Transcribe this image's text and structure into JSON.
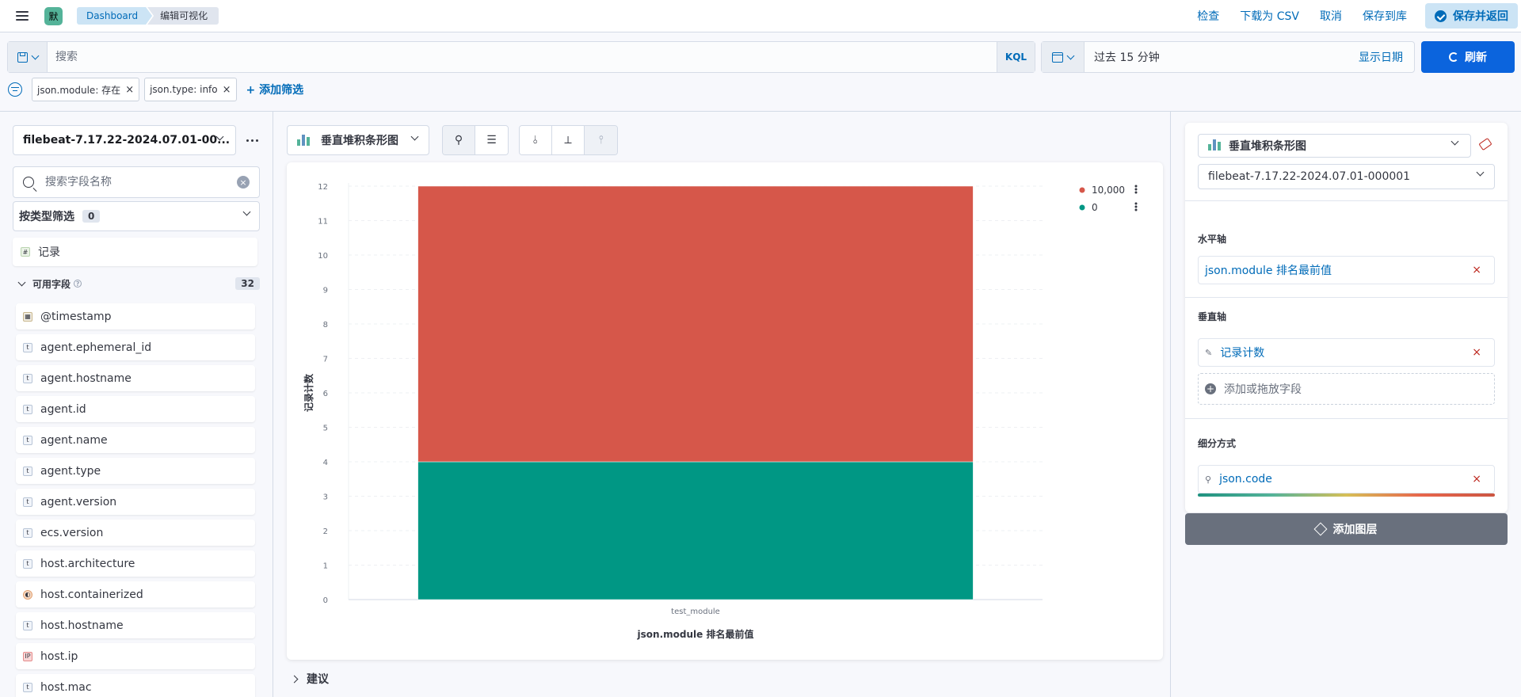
{
  "header": {
    "logo_letter": "默",
    "breadcrumbs": [
      "Dashboard",
      "编辑可视化"
    ],
    "actions": [
      "检查",
      "下载为 CSV",
      "取消",
      "保存到库"
    ],
    "save_return": "保存并返回"
  },
  "query": {
    "search_placeholder": "搜索",
    "language": "KQL",
    "time_range": "过去 15 分钟",
    "show_dates": "显示日期",
    "refresh": "刷新",
    "filters": [
      "json.module: 存在",
      "json.type: info"
    ],
    "add_filter": "+ 添加筛选"
  },
  "sidebar": {
    "data_view": "filebeat-7.17.22-2024.07.01-00...",
    "field_search_placeholder": "搜索字段名称",
    "type_filter_label": "按类型筛选",
    "type_filter_count": "0",
    "records_label": "记录",
    "available_label": "可用字段",
    "available_count": "32",
    "fields": [
      {
        "name": "@timestamp",
        "type": "date"
      },
      {
        "name": "agent.ephemeral_id",
        "type": "text"
      },
      {
        "name": "agent.hostname",
        "type": "text"
      },
      {
        "name": "agent.id",
        "type": "text"
      },
      {
        "name": "agent.name",
        "type": "text"
      },
      {
        "name": "agent.type",
        "type": "text"
      },
      {
        "name": "agent.version",
        "type": "text"
      },
      {
        "name": "ecs.version",
        "type": "text"
      },
      {
        "name": "host.architecture",
        "type": "text"
      },
      {
        "name": "host.containerized",
        "type": "bool"
      },
      {
        "name": "host.hostname",
        "type": "text"
      },
      {
        "name": "host.ip",
        "type": "ip"
      },
      {
        "name": "host.mac",
        "type": "text"
      }
    ]
  },
  "workspace": {
    "chart_type_label": "垂直堆积条形图",
    "suggestions_label": "建议"
  },
  "chart_data": {
    "type": "bar",
    "stacked": true,
    "categories": [
      "test_module"
    ],
    "series": [
      {
        "name": "0",
        "values": [
          4
        ],
        "color": "#009784"
      },
      {
        "name": "10,000",
        "values": [
          8
        ],
        "color": "#d6574a"
      }
    ],
    "xlabel": "json.module 排名最前值",
    "ylabel": "记录计数",
    "ylim": [
      0,
      12
    ],
    "yticks": [
      0,
      1,
      2,
      3,
      4,
      5,
      6,
      7,
      8,
      9,
      10,
      11,
      12
    ],
    "legend_order": [
      "10,000",
      "0"
    ],
    "legend_position": "top-right",
    "grid": true
  },
  "config": {
    "layer_type": "垂直堆积条形图",
    "layer_data_view": "filebeat-7.17.22-2024.07.01-000001",
    "x_axis_label": "水平轴",
    "x_axis_field": "json.module 排名最前值",
    "y_axis_label": "垂直轴",
    "y_axis_field": "记录计数",
    "add_field": "添加或拖放字段",
    "breakdown_label": "细分方式",
    "breakdown_field": "json.code",
    "add_layer": "添加图层"
  }
}
